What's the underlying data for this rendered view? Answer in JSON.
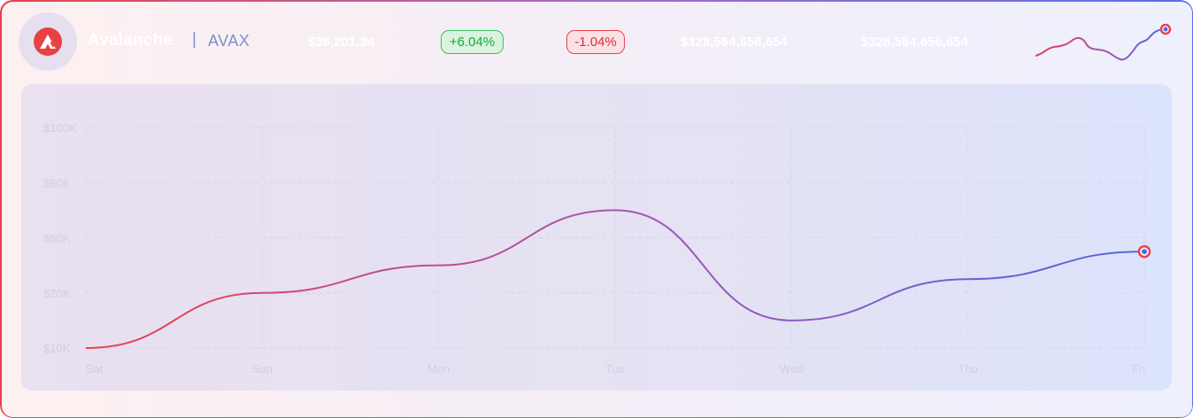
{
  "header": {
    "coin_name": "Avalanche",
    "separator": "|",
    "symbol": "AVAX",
    "price": "$36,201.34",
    "change_24h": "+6.04%",
    "change_7d": "-1.04%",
    "market_cap": "$328,564,656,654",
    "volume": "$328,564,656,654",
    "logo_icon": "avalanche-logo-icon"
  },
  "colors": {
    "line_start": "#e8434d",
    "line_mid": "#a656b0",
    "line_end": "#5468e0",
    "positive": "#16a83a",
    "negative": "#d8313b"
  },
  "chart_data": {
    "type": "line",
    "categories": [
      "Sat",
      "Sun",
      "Mon",
      "Tue",
      "Wed",
      "Thu",
      "Fri"
    ],
    "y_ticks": [
      "$100K",
      "$80K",
      "$60K",
      "$20K",
      "$10K"
    ],
    "y_tick_values": [
      100,
      80,
      60,
      20,
      10
    ],
    "series": [
      {
        "values": [
          10,
          20,
          40,
          70,
          15,
          30,
          50
        ]
      }
    ],
    "grid": true,
    "xlabel": "",
    "ylabel": ""
  },
  "sparkline": {
    "values": [
      2,
      5,
      9,
      4,
      3,
      1,
      6,
      10
    ]
  }
}
